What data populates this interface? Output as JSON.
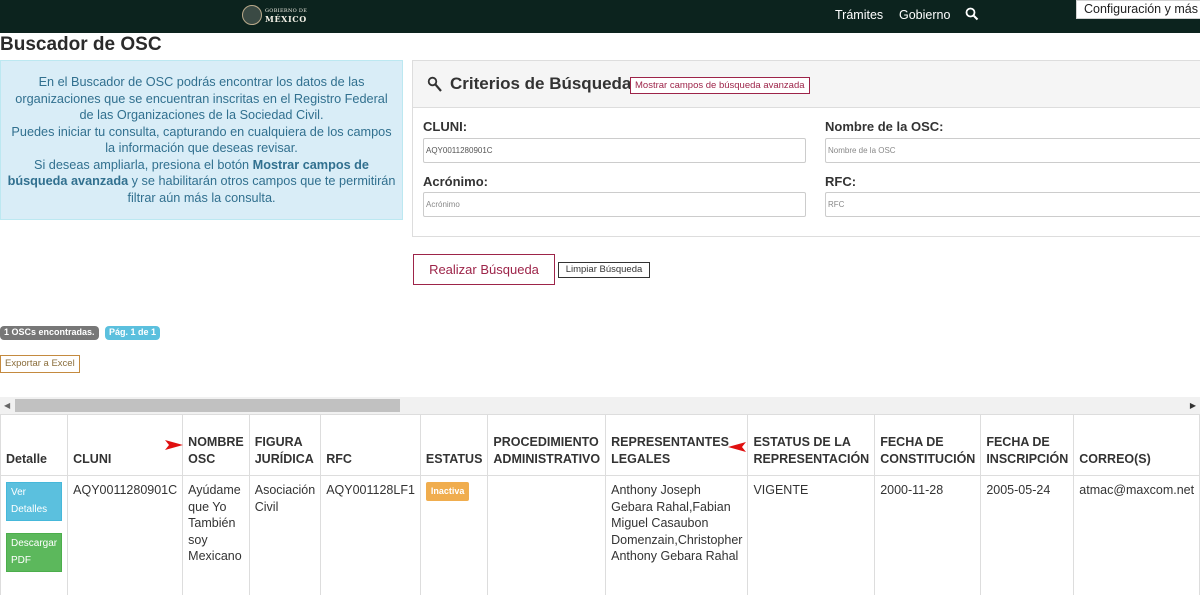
{
  "header": {
    "logo_line1": "GOBIERNO DE",
    "logo_line2": "MÉXICO",
    "nav_tramites": "Trámites",
    "nav_gobierno": "Gobierno",
    "config_label": "Configuración y más (A"
  },
  "page_title": "Buscador de OSC",
  "info": {
    "line1": "En el Buscador de OSC podrás encontrar los datos de las organizaciones que se encuentran inscritas en el Registro Federal de las Organizaciones de la Sociedad Civil.",
    "line2": "Puedes iniciar tu consulta, capturando en cualquiera de los campos la información que deseas revisar.",
    "line3_pre": "Si deseas ampliarla, presiona el botón ",
    "line3_bold": "Mostrar campos de búsqueda avanzada",
    "line3_post": " y se habilitarán otros campos que te permitirán filtrar aún más la consulta."
  },
  "search": {
    "title": "Criterios de Búsqueda",
    "advanced_button": "Mostrar campos de búsqueda avanzada",
    "cluni_label": "CLUNI:",
    "cluni_value": "AQY0011280901C",
    "nombre_label": "Nombre de la OSC:",
    "nombre_placeholder": "Nombre de la OSC",
    "acronimo_label": "Acrónimo:",
    "acronimo_placeholder": "Acrónimo",
    "rfc_label": "RFC:",
    "rfc_placeholder": "RFC",
    "submit_button": "Realizar Búsqueda",
    "clear_button": "Limpiar Búsqueda"
  },
  "results": {
    "found_badge": "1 OSCs encontradas.",
    "page_badge": "Pág. 1 de 1",
    "export_button": "Exportar a Excel"
  },
  "table": {
    "headers": {
      "detalle": "Detalle",
      "cluni": "CLUNI",
      "nombre": "NOMBRE OSC",
      "figura": "FIGURA JURÍDICA",
      "rfc": "RFC",
      "estatus": "ESTATUS",
      "procedimiento": "PROCEDIMIENTO ADMINISTRATIVO",
      "representantes": "REPRESENTANTES LEGALES",
      "estatus_rep": "ESTATUS DE LA REPRESENTACIÓN",
      "fecha_const": "FECHA DE CONSTITUCIÓN",
      "fecha_insc": "FECHA DE INSCRIPCIÓN",
      "correo": "CORREO(S)"
    },
    "row": {
      "ver_detalles": "Ver Detalles",
      "descargar_pdf": "Descargar PDF",
      "cluni": "AQY0011280901C",
      "nombre": "Ayúdame que Yo También soy Mexicano",
      "figura": "Asociación Civil",
      "rfc": "AQY001128LF1",
      "estatus": "Inactiva",
      "procedimiento": "",
      "representantes": "Anthony Joseph Gebara Rahal,Fabian Miguel Casaubon Domenzain,Christopher Anthony Gebara Rahal",
      "estatus_rep": "VIGENTE",
      "fecha_const": "2000-11-28",
      "fecha_insc": "2005-05-24",
      "correo": "atmac@maxcom.net"
    }
  },
  "colors": {
    "topbar": "#0c231e",
    "accent": "#9d2449",
    "info_bg": "#d9edf7",
    "info_text": "#31708f",
    "annotation_arrow": "#e01010"
  }
}
